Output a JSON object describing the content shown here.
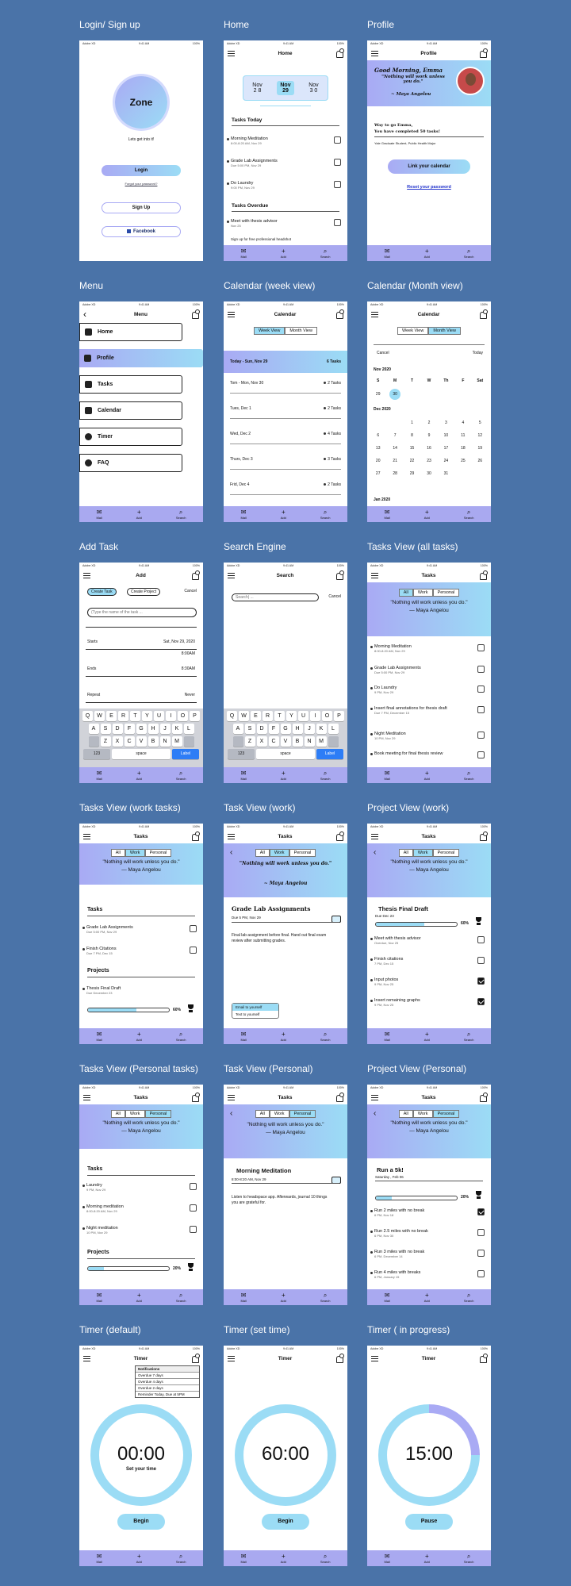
{
  "status": {
    "carrier": "Adobe XD",
    "time": "9:41 AM",
    "battery": "100%"
  },
  "tabbar": {
    "mail": "Mail",
    "add": "Add",
    "search": "Search"
  },
  "titles": {
    "login": "Login/ Sign up",
    "home": "Home",
    "profile": "Profile",
    "menu": "Menu",
    "calendar_week": "Calendar (week view)",
    "calendar_month": "Calendar (Month view)",
    "add_task": "Add Task",
    "search": "Search Engine",
    "tasks_all": "Tasks View (all tasks)",
    "tasks_work": "Tasks View (work tasks)",
    "task_work": "Task View (work)",
    "project_work": "Project View (work)",
    "tasks_personal": "Tasks View (Personal tasks)",
    "task_personal": "Task View (Personal)",
    "project_personal": "Project View (Personal)",
    "timer_default": "Timer (default)",
    "timer_set": "Timer (set time)",
    "timer_progress": "Timer ( in progress)"
  },
  "login": {
    "logo": "Zone",
    "tagline": "Lets get into it!",
    "login_btn": "Login",
    "forgot": "Forgot your password?",
    "signup_btn": "Sign Up",
    "facebook_btn": "Facebook"
  },
  "home": {
    "header": "Home",
    "dates": [
      {
        "m": "Nov",
        "d": "2 8"
      },
      {
        "m": "Nov",
        "d": "29"
      },
      {
        "m": "Nov",
        "d": "3 0"
      }
    ],
    "today_title": "Tasks Today",
    "today": [
      {
        "t": "Morning Meditation",
        "s": "8:00-8:20 AM, Nov 29"
      },
      {
        "t": "Grade Lab Assignments",
        "s": "Due 5:00 PM, Nov 29"
      },
      {
        "t": "Do Laundry",
        "s": "9:00 PM, Nov 29"
      }
    ],
    "overdue_title": "Tasks Overdue",
    "overdue": [
      {
        "t": "Meet with thesis advisor",
        "s": "Nov 25"
      },
      {
        "t": "Sign up for free professional headshot",
        "s": ""
      }
    ]
  },
  "profile": {
    "header": "Profile",
    "greeting": "Good Morning, Emma",
    "quote": "\"Nothing will work unless you do.\"",
    "author": "~ Maya Angelou",
    "praise1": "Way to go Emma,",
    "praise2": "You have completed 50 tasks!",
    "school": "Yale Graduate Student, Public Health Major",
    "link_btn": "Link your calendar",
    "reset": "Reset your password"
  },
  "menu": {
    "header": "Menu",
    "items": [
      "Home",
      "Profile",
      "Tasks",
      "Calendar",
      "Timer",
      "FAQ"
    ]
  },
  "calweek": {
    "header": "Calendar",
    "seg": [
      "Week View",
      "Month View"
    ],
    "today": "Today - Sun, Nov 29",
    "today_count": "6 Tasks",
    "days": [
      {
        "d": "Tom - Mon, Nov 30",
        "c": "2 Tasks"
      },
      {
        "d": "Tues, Dec 1",
        "c": "2 Tasks"
      },
      {
        "d": "Wed, Dec 2",
        "c": "4 Tasks"
      },
      {
        "d": "Thurs, Dec 3",
        "c": "3 Tasks"
      },
      {
        "d": "Frid, Dec 4",
        "c": "2 Tasks"
      }
    ]
  },
  "calmonth": {
    "header": "Calendar",
    "seg": [
      "Week View",
      "Month View"
    ],
    "cancel": "Cancel",
    "today": "Today",
    "nov": "Nov 2020",
    "dec": "Dec 2020",
    "jan": "Jan 2020",
    "dow": [
      "S",
      "M",
      "T",
      "W",
      "Th",
      "F",
      "Sat"
    ],
    "novdays": [
      "29",
      "30",
      "",
      "",
      "",
      "",
      ""
    ],
    "decdays": [
      "",
      "",
      "1",
      "2",
      "3",
      "4",
      "5",
      "6",
      "7",
      "8",
      "9",
      "10",
      "11",
      "12",
      "13",
      "14",
      "15",
      "16",
      "17",
      "18",
      "19",
      "20",
      "21",
      "22",
      "23",
      "24",
      "25",
      "26",
      "27",
      "28",
      "29",
      "30",
      "31",
      "",
      ""
    ]
  },
  "addtask": {
    "header": "Add",
    "create_task": "Create Task",
    "create_project": "Create Project",
    "cancel": "Cancel",
    "placeholder": "(Type the name of the task ...",
    "starts": "Starts",
    "starts_val": "Sat, Nov 29, 2020",
    "starts_time": "8:00AM",
    "ends": "Ends",
    "ends_val": "8:30AM",
    "repeat": "Repeat",
    "repeat_val": "Never"
  },
  "keyboard": {
    "r1": [
      "Q",
      "W",
      "E",
      "R",
      "T",
      "Y",
      "U",
      "I",
      "O",
      "P"
    ],
    "r2": [
      "A",
      "S",
      "D",
      "F",
      "G",
      "H",
      "J",
      "K",
      "L"
    ],
    "r3": [
      "Z",
      "X",
      "C",
      "V",
      "B",
      "N",
      "M"
    ],
    "num": "123",
    "space": "space",
    "label": "Label"
  },
  "search": {
    "header": "Search",
    "placeholder": "Search| ...",
    "cancel": "Cancel"
  },
  "tasks": {
    "header": "Tasks",
    "seg": [
      "All",
      "Work",
      "Personal"
    ],
    "quote": "\"Nothing will work unless you do.\"",
    "author": "— Maya Angelou",
    "tasks_title": "Tasks",
    "projects_title": "Projects"
  },
  "tasks_all": [
    {
      "t": "Morning Meditation",
      "s": "8:00-8:20 AM, Nov 29"
    },
    {
      "t": "Grade Lab Assignments",
      "s": "Due 5:00 PM, Nov 29"
    },
    {
      "t": "Do Laundry",
      "s": "9 PM, Nov 29"
    },
    {
      "t": "Insert final annotations for thesis draft",
      "s": "Due 7 PM, December 15"
    },
    {
      "t": "Night Meditation",
      "s": "10 PM, Nov 29"
    },
    {
      "t": "Book meeting for final thesis review",
      "s": ""
    }
  ],
  "tasks_work": [
    {
      "t": "Grade Lab Assignments",
      "s": "Due 5:00 PM, Nov 29"
    },
    {
      "t": "Finish Citations",
      "s": "Due 7 PM, Dec 15"
    }
  ],
  "project_work_row": {
    "t": "Thesis Final Draft",
    "s": "Due December 23",
    "pct": "60%",
    "progress": 0.6
  },
  "task_work": {
    "quote": "\"Nothing will work unless you do.\"",
    "author": "~ Maya Angelou",
    "title": "Grade Lab Assignments",
    "due": "Due 5 PM, Nov 29",
    "desc": "Final lab assignment before final. Hand out final exam review after submitting grades.",
    "email": "Email to yourself",
    "text": "Text to yourself"
  },
  "project_work": {
    "title": "Thesis Final Draft",
    "due": "Due Dec 23",
    "pct": "60%",
    "progress": 0.6,
    "items": [
      {
        "t": "Meet with thesis advisor",
        "s": "Overdue, Nov 25",
        "c": false
      },
      {
        "t": "Finish citations",
        "s": "7 PM, Dec 15",
        "c": false
      },
      {
        "t": "Input photos",
        "s": "9 PM, Nov 25",
        "c": true
      },
      {
        "t": "Insert remaining graphs",
        "s": "9 PM, Nov 25",
        "c": true
      }
    ]
  },
  "tasks_personal": [
    {
      "t": "Laundry",
      "s": "9 PM, Nov 29"
    },
    {
      "t": "Morning meditation",
      "s": "8:00-8:20 AM, Nov 29"
    },
    {
      "t": "Night meditation",
      "s": "10 PM, Nov 29"
    }
  ],
  "personal_project_pct": "20%",
  "personal_progress": 0.2,
  "task_personal": {
    "title": "Morning Meditation",
    "time": "8:00-8:20 AM, Nov 29",
    "desc": "Listen to headspace app. Afterwards, journal 10 things you are grateful for."
  },
  "project_personal": {
    "title": "Run a 5k!",
    "date": "Saturday , Feb 06",
    "pct": "20%",
    "progress": 0.2,
    "items": [
      {
        "t": "Run 2 miles with no break",
        "s": "6 PM, Nov 18",
        "c": true
      },
      {
        "t": "Run 2.5 miles with no break",
        "s": "6 PM, Nov 30",
        "c": false
      },
      {
        "t": "Run 3 miles with no break",
        "s": "6 PM, December 14",
        "c": false
      },
      {
        "t": "Run 4 miles with breaks",
        "s": "6 PM, January 15",
        "c": false
      }
    ]
  },
  "timer": {
    "header": "Timer",
    "t0": "00:00",
    "set": "Set your time",
    "t60": "60:00",
    "t15": "15:00",
    "begin": "Begin",
    "pause": "Pause",
    "progress": 0.25,
    "notif_title": "Notifications",
    "notifs": [
      "Overdue 7 days",
      "Overdue 4 days",
      "Overdue 2 days",
      "Reminder Today, Due at 5PM"
    ]
  }
}
